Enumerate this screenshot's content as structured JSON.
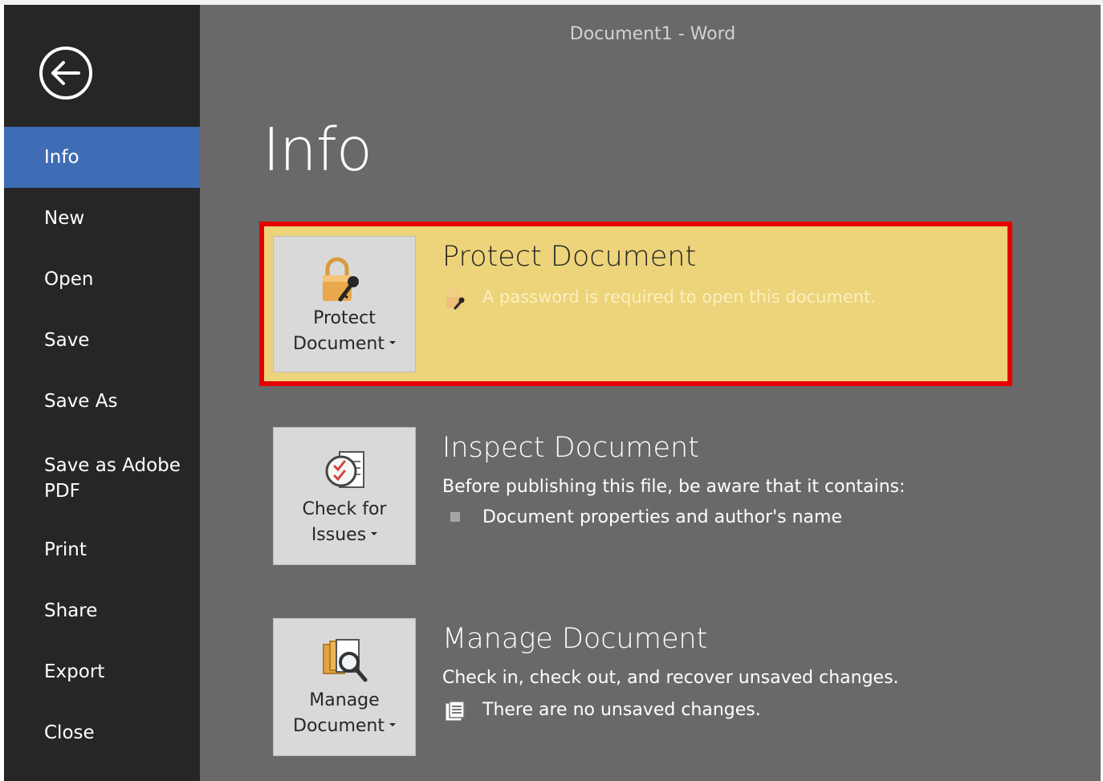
{
  "window": {
    "title": "Document1 - Word"
  },
  "sidebar": {
    "back_icon": "back-arrow-icon",
    "items": [
      {
        "label": "Info",
        "active": true
      },
      {
        "label": "New"
      },
      {
        "label": "Open"
      },
      {
        "label": "Save"
      },
      {
        "label": "Save As"
      },
      {
        "label": "Save as Adobe\nPDF"
      },
      {
        "label": "Print"
      },
      {
        "label": "Share"
      },
      {
        "label": "Export"
      },
      {
        "label": "Close"
      }
    ]
  },
  "main": {
    "title": "Info",
    "protect": {
      "button_label": "Protect\nDocument",
      "title": "Protect Document",
      "status": "A password is required to open this document.",
      "icon": "lock-key-icon"
    },
    "inspect": {
      "button_label": "Check for\nIssues",
      "title": "Inspect Document",
      "description": "Before publishing this file, be aware that it contains:",
      "items": [
        "Document properties and author's name"
      ],
      "icon": "checklist-icon"
    },
    "manage": {
      "button_label": "Manage\nDocument",
      "title": "Manage Document",
      "description": "Check in, check out, and recover unsaved changes.",
      "status": "There are no unsaved changes.",
      "icon": "manage-document-icon"
    }
  },
  "colors": {
    "sidebar_bg": "#262626",
    "active_nav": "#3e6db5",
    "main_bg": "#696969",
    "highlight_fill": "#edd47a",
    "highlight_border": "#e50000"
  }
}
